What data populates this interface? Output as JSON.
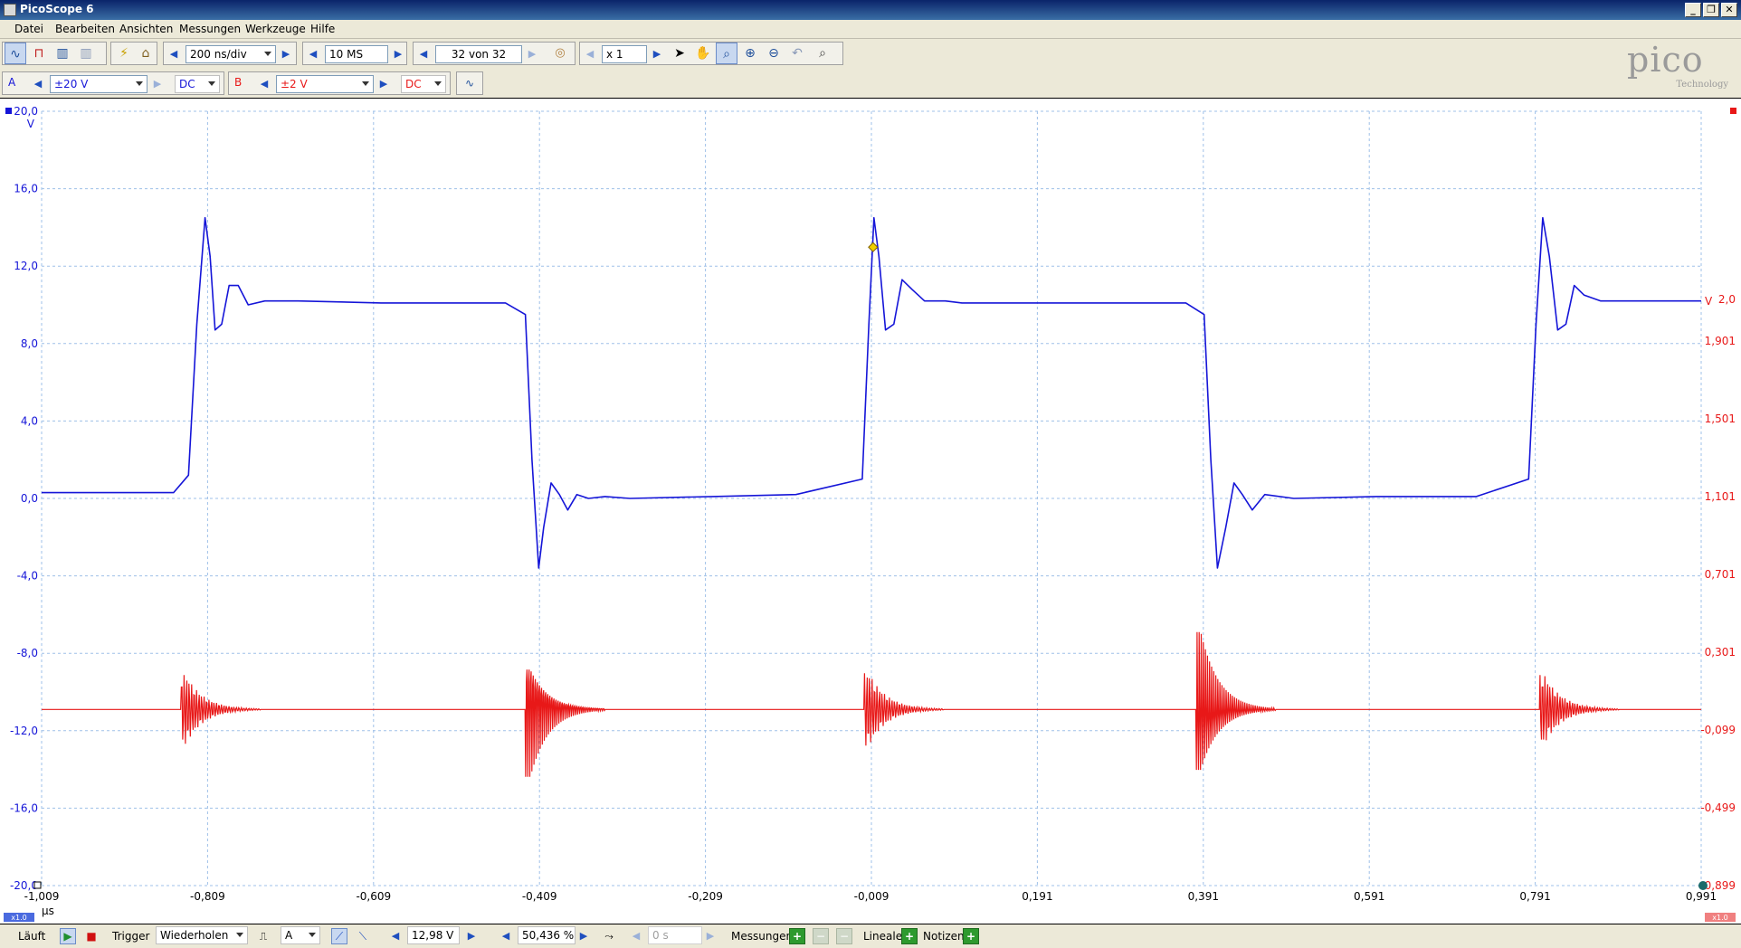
{
  "window": {
    "title": "PicoScope 6",
    "buttons": [
      "_",
      "❐",
      "✕"
    ]
  },
  "menu": [
    "Datei",
    "Bearbeiten",
    "Ansichten",
    "Messungen",
    "Werkzeuge",
    "Hilfe"
  ],
  "toolbar": {
    "timebase": "200 ns/div",
    "samples": "10 MS",
    "buffer": "32 von 32",
    "zoom": "x 1"
  },
  "channel_a": {
    "label": "A",
    "range": "±20 V",
    "coupling": "DC",
    "color": "#1515d8"
  },
  "channel_b": {
    "label": "B",
    "range": "±2 V",
    "coupling": "DC",
    "color": "#e81818"
  },
  "logo": {
    "word": "pico",
    "sub": "Technology"
  },
  "axes": {
    "left_unit": "V",
    "left_ticks": [
      "20,0",
      "16,0",
      "12,0",
      "8,0",
      "4,0",
      "0,0",
      "-4,0",
      "-8,0",
      "-12,0",
      "-16,0",
      "-20,0"
    ],
    "right_unit": "V",
    "right_ticks": [
      "2,0",
      "1,901",
      "1,501",
      "1,101",
      "0,701",
      "0,301",
      "-0,099",
      "-0,499",
      "-0,899"
    ],
    "x_ticks": [
      "-1,009",
      "-0,809",
      "-0,609",
      "-0,409",
      "-0,209",
      "-0,009",
      "0,191",
      "0,391",
      "0,591",
      "0,791",
      "0,991"
    ],
    "x_unit": "µs",
    "scale_a": "x1.0",
    "scale_b": "x1.0"
  },
  "chart_data": {
    "type": "line",
    "x_label": "µs",
    "x_range": [
      -1.009,
      0.991
    ],
    "y_left_range": [
      -20,
      20
    ],
    "y_right_range": [
      -0.899,
      2.0
    ],
    "grid": true,
    "series": [
      {
        "name": "A",
        "axis": "left",
        "color": "#1515d8",
        "x": [
          -1.009,
          -0.85,
          -0.832,
          -0.822,
          -0.812,
          -0.806,
          -0.8,
          -0.792,
          -0.783,
          -0.772,
          -0.76,
          -0.74,
          -0.7,
          -0.6,
          -0.45,
          -0.426,
          -0.418,
          -0.41,
          -0.404,
          -0.395,
          -0.385,
          -0.375,
          -0.364,
          -0.35,
          -0.33,
          -0.3,
          -0.2,
          -0.1,
          -0.02,
          -0.012,
          -0.006,
          0.0,
          0.008,
          0.018,
          0.028,
          0.04,
          0.055,
          0.08,
          0.1,
          0.2,
          0.3,
          0.37,
          0.392,
          0.4,
          0.408,
          0.418,
          0.428,
          0.438,
          0.45,
          0.465,
          0.5,
          0.6,
          0.72,
          0.783,
          0.792,
          0.8,
          0.808,
          0.818,
          0.828,
          0.838,
          0.85,
          0.87,
          0.92,
          0.991
        ],
        "y": [
          0.3,
          0.3,
          1.2,
          9.0,
          14.5,
          12.5,
          8.7,
          9.0,
          11.0,
          11.0,
          10.0,
          10.2,
          10.2,
          10.1,
          10.1,
          9.5,
          2.0,
          -3.6,
          -1.5,
          0.8,
          0.2,
          -0.6,
          0.2,
          0.0,
          0.1,
          0.0,
          0.1,
          0.2,
          1.0,
          9.0,
          14.5,
          12.5,
          8.7,
          9.0,
          11.3,
          10.8,
          10.2,
          10.2,
          10.1,
          10.1,
          10.1,
          10.1,
          9.5,
          2.0,
          -3.6,
          -1.5,
          0.8,
          0.2,
          -0.6,
          0.2,
          0.0,
          0.1,
          0.1,
          1.0,
          9.0,
          14.5,
          12.5,
          8.7,
          9.0,
          11.0,
          10.5,
          10.2,
          10.2,
          10.2
        ]
      },
      {
        "name": "B",
        "axis": "right",
        "color": "#e81818",
        "center": 0.0,
        "baseline_left_units": -10.9,
        "bursts": [
          {
            "x": -0.835,
            "amp_left_units": 1.8,
            "cycles": 10
          },
          {
            "x": -0.42,
            "amp_left_units": 3.5,
            "cycles": 12
          },
          {
            "x": -0.012,
            "amp_left_units": 1.9,
            "cycles": 10
          },
          {
            "x": 0.388,
            "amp_left_units": 4.2,
            "cycles": 12
          },
          {
            "x": 0.802,
            "amp_left_units": 1.8,
            "cycles": 10
          }
        ]
      }
    ]
  },
  "statusbar": {
    "run": "Läuft",
    "trigger_label": "Trigger",
    "trigger_mode": "Wiederholen",
    "trigger_channel": "A",
    "trigger_level": "12,98 V",
    "pretrigger": "50,436 %",
    "delay": "0 s",
    "measurements": "Messungen",
    "rulers": "Lineale",
    "notes": "Notizen"
  }
}
